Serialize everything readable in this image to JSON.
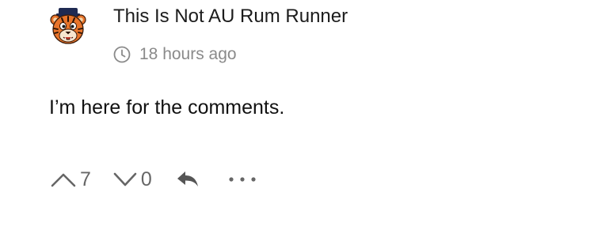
{
  "comment": {
    "username": "This Is Not AU Rum Runner",
    "timestamp": "18 hours ago",
    "body": "I’m here for the comments.",
    "upvotes": "7",
    "downvotes": "0"
  },
  "icons": {
    "avatar": "tiger-mascot-avatar",
    "clock": "clock-icon",
    "upvote": "chevron-up-icon",
    "downvote": "chevron-down-icon",
    "reply": "reply-arrow-icon",
    "more": "more-dots-icon"
  },
  "colors": {
    "text": "#1c1c1c",
    "muted": "#8a8a8a",
    "action": "#666666",
    "tiger_orange": "#e8742a",
    "navy": "#1f2a52"
  }
}
